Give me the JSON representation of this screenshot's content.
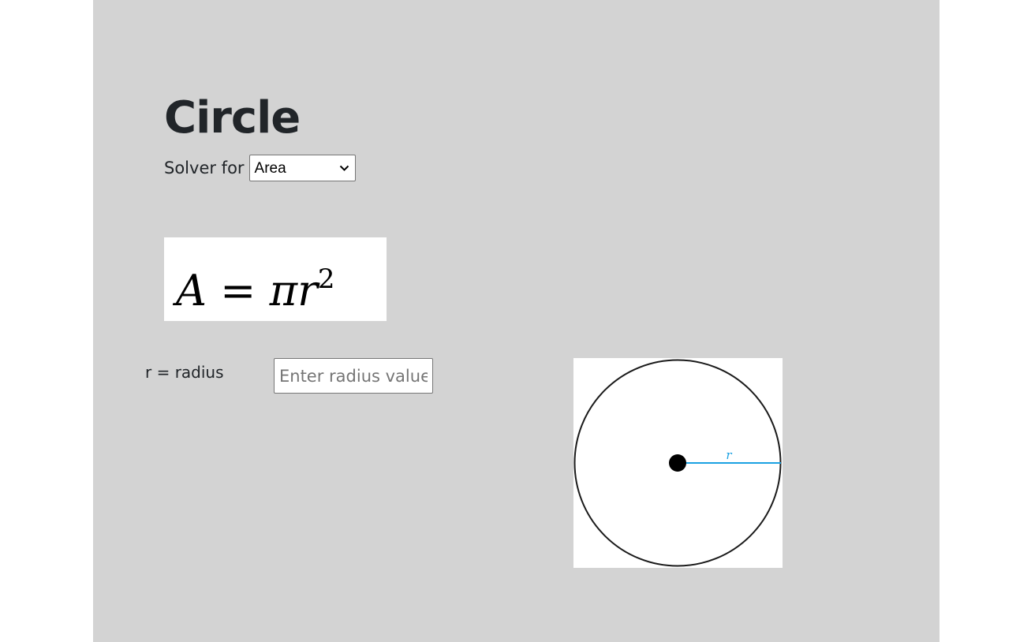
{
  "page": {
    "title": "Circle",
    "solver_label": "Solver for",
    "solver_select": {
      "selected": "Area"
    },
    "formula": {
      "lhs": "A",
      "operator": "=",
      "rhs_base": "πr",
      "exponent": "2"
    },
    "radius": {
      "label": "r = radius",
      "input_value": "",
      "placeholder": "Enter radius value"
    },
    "diagram": {
      "radius_label": "r",
      "radius_line_color": "#1ba1e2",
      "outline_color": "#1a1a1a",
      "center_dot_color": "#000000"
    }
  },
  "colors": {
    "panel_background": "#d3d3d3",
    "page_background": "#ffffff",
    "text": "#212529"
  }
}
